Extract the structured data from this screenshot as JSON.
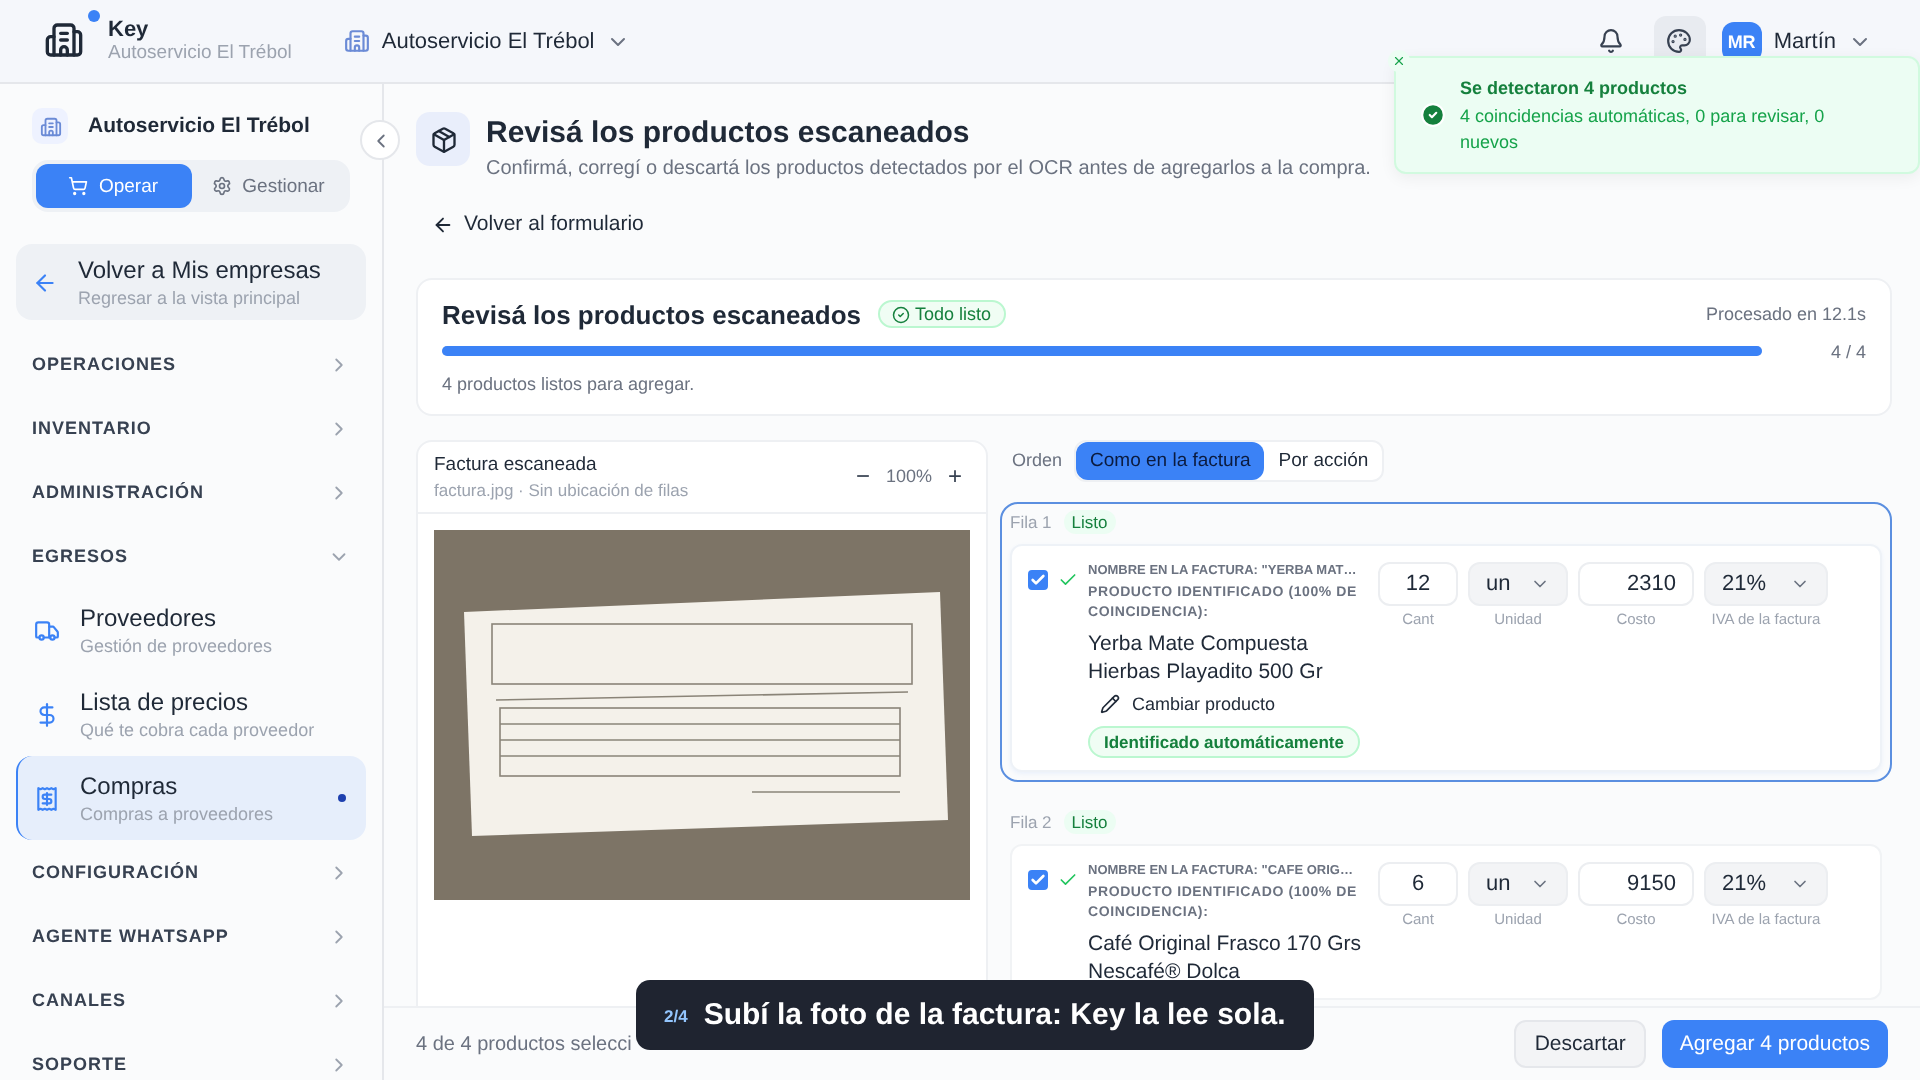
{
  "topbar": {
    "app_name": "Key",
    "app_store": "Autoservicio El Trébol",
    "store_selector": "Autoservicio El Trébol",
    "notification_dot": true,
    "user_initials": "MR",
    "user_name": "Martín"
  },
  "toast": {
    "title": "Se detectaron 4 productos",
    "message": "4 coincidencias automáticas, 0 para revisar, 0 nuevos"
  },
  "sidebar": {
    "store": "Autoservicio El Trébol",
    "modes": [
      {
        "label": "Operar",
        "selected": true
      },
      {
        "label": "Gestionar",
        "selected": false
      }
    ],
    "back": {
      "title": "Volver a Mis empresas",
      "subtitle": "Regresar a la vista principal"
    },
    "sections": [
      {
        "label": "OPERACIONES",
        "expanded": false
      },
      {
        "label": "INVENTARIO",
        "expanded": false
      },
      {
        "label": "ADMINISTRACIÓN",
        "expanded": false
      },
      {
        "label": "EGRESOS",
        "expanded": true,
        "children": [
          {
            "title": "Proveedores",
            "subtitle": "Gestión de proveedores",
            "selected": false
          },
          {
            "title": "Lista de precios",
            "subtitle": "Qué te cobra cada proveedor",
            "selected": false
          },
          {
            "title": "Compras",
            "subtitle": "Compras a proveedores",
            "selected": true
          }
        ]
      },
      {
        "label": "CONFIGURACIÓN",
        "expanded": false
      },
      {
        "label": "AGENTE WHATSAPP",
        "expanded": false
      },
      {
        "label": "CANALES",
        "expanded": false
      },
      {
        "label": "SOPORTE",
        "expanded": false
      }
    ]
  },
  "page": {
    "title": "Revisá los productos escaneados",
    "subtitle": "Confirmá, corregí o descartá los productos detectados por el OCR antes de agregarlos a la compra.",
    "back_link": "Volver al formulario"
  },
  "progress": {
    "title": "Revisá los productos escaneados",
    "badge": "Todo listo",
    "time": "Procesado en 12.1s",
    "level": 1,
    "count": "4 / 4",
    "note": "4 productos listos para agregar."
  },
  "invoice": {
    "title": "Factura escaneada",
    "subtitle": "factura.jpg · Sin ubicación de filas",
    "zoom": "100%",
    "zoom_out": "−",
    "zoom_in": "+"
  },
  "order": {
    "label": "Orden",
    "options": [
      {
        "label": "Como en la factura",
        "selected": true
      },
      {
        "label": "Por acción",
        "selected": false
      }
    ]
  },
  "rows": [
    {
      "label": "Fila 1",
      "status": "Listo",
      "focused": true,
      "checked": true,
      "invoice_name": "NOMBRE EN LA FACTURA: \"YERBA MAT…",
      "identified": "PRODUCTO IDENTIFICADO (100% DE COINCIDENCIA):",
      "product": "Yerba Mate Compuesta Hierbas Playadito 500 Gr",
      "change": "Cambiar producto",
      "badge": "Identificado automáticamente",
      "qty": "12",
      "qty_label": "Cant",
      "unit": "un",
      "unit_label": "Unidad",
      "cost": "2310",
      "cost_label": "Costo",
      "iva": "21%",
      "iva_label": "IVA de la factura"
    },
    {
      "label": "Fila 2",
      "status": "Listo",
      "focused": false,
      "checked": true,
      "invoice_name": "NOMBRE EN LA FACTURA: \"CAFE ORIG…",
      "identified": "PRODUCTO IDENTIFICADO (100% DE COINCIDENCIA):",
      "product": "Café Original Frasco 170 Grs Nescafé® Dolca",
      "qty": "6",
      "qty_label": "Cant",
      "unit": "un",
      "unit_label": "Unidad",
      "cost": "9150",
      "cost_label": "Costo",
      "iva": "21%",
      "iva_label": "IVA de la factura"
    }
  ],
  "footer": {
    "selected_text": "4 de 4 productos selecci",
    "discard": "Descartar",
    "add": "Agregar 4 productos"
  },
  "caption": {
    "step": "2/4",
    "text": "Subí la foto de la factura: Key la lee sola."
  }
}
